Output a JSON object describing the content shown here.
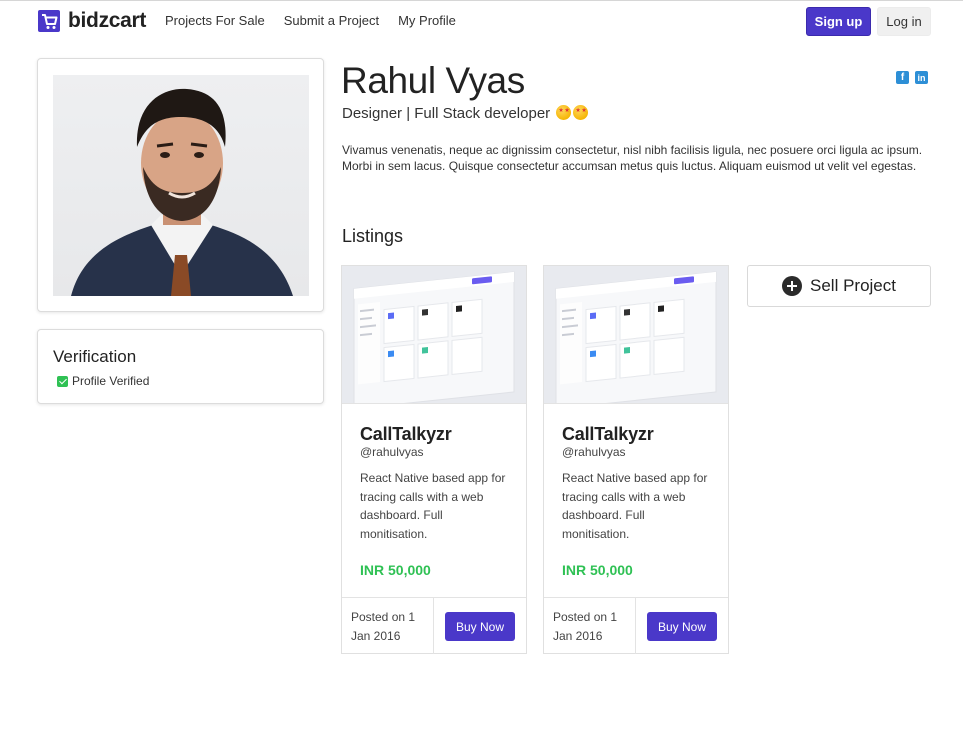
{
  "brand": {
    "name": "bidzcart",
    "accent": "#4a38c9"
  },
  "nav": {
    "links": [
      "Projects For Sale",
      "Submit a Project",
      "My Profile"
    ],
    "signup_label": "Sign up",
    "login_label": "Log in"
  },
  "profile": {
    "name": "Rahul Vyas",
    "role": "Designer | Full Stack developer",
    "role_emoji": "star-struck-emoji",
    "bio": "Vivamus venenatis, neque ac dignissim consectetur, nisl nibh facilisis ligula, nec posuere orci ligula ac ipsum. Morbi in sem lacus. Quisque consectetur accumsan metus quis luctus. Aliquam euismod ut velit vel egestas.",
    "photo": "profile-photo",
    "social": [
      "facebook-icon",
      "linkedin-icon"
    ]
  },
  "verification": {
    "title": "Verification",
    "item": "Profile Verified",
    "check_color": "#2fc154"
  },
  "listings": {
    "title": "Listings",
    "sell_label": "Sell Project",
    "price_color": "#2fc154",
    "items": [
      {
        "title": "CallTalkyzr",
        "handle": "@rahulvyas",
        "description": "React Native based app for tracing calls with a web dashboard. Full monitisation.",
        "price": "INR 50,000",
        "posted": "Posted on 1 Jan 2016",
        "buy_label": "Buy Now"
      },
      {
        "title": "CallTalkyzr",
        "handle": "@rahulvyas",
        "description": "React Native based app for tracing calls with a web dashboard. Full monitisation.",
        "price": "INR 50,000",
        "posted": "Posted on 1 Jan 2016",
        "buy_label": "Buy Now"
      }
    ]
  }
}
